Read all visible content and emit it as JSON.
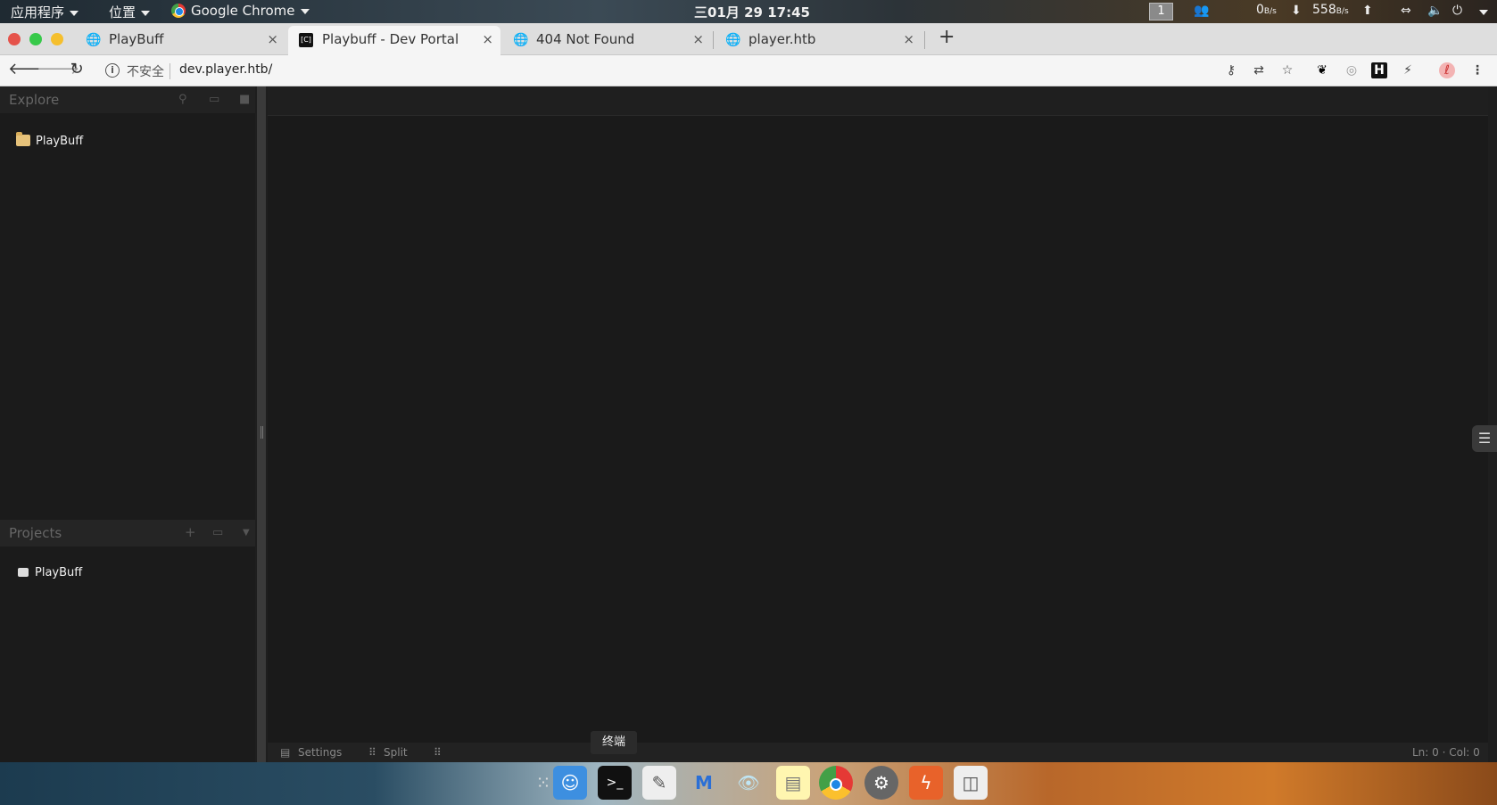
{
  "topbar": {
    "apps_menu": "应用程序",
    "places_menu": "位置",
    "active_app": "Google Chrome",
    "clock": "三01月 29  17:45",
    "workspace": "1",
    "net_down": "0",
    "net_down_unit": "B/s",
    "net_up": "558",
    "net_up_unit": "B/s"
  },
  "tabs": [
    {
      "title": "PlayBuff",
      "close": "×"
    },
    {
      "title": "Playbuff - Dev Portal",
      "close": "×"
    },
    {
      "title": "404 Not Found",
      "close": "×"
    },
    {
      "title": "player.htb",
      "close": "×"
    }
  ],
  "new_tab": "+",
  "omnibox": {
    "security_label": "不安全",
    "url": "dev.player.htb/"
  },
  "explore_panel": {
    "title": "Explore",
    "items": [
      {
        "label": "PlayBuff"
      }
    ]
  },
  "projects_panel": {
    "title": "Projects",
    "add": "+",
    "items": [
      {
        "label": "PlayBuff"
      }
    ]
  },
  "statusbar": {
    "settings": "Settings",
    "split": "Split",
    "cursor": "Ln: 0 · Col: 0"
  },
  "tooltip": "终端",
  "dock": {
    "apps": [
      "apps-grid",
      "finder",
      "terminal",
      "text-editor",
      "malwarebytes",
      "eye-viewer",
      "notes",
      "chrome",
      "system-prefs",
      "burp",
      "app-drawer"
    ]
  },
  "colors": {
    "page_bg": "#1b1b1b",
    "tab_active": "#f5f5f5",
    "tab_strip": "#dedede",
    "folder": "#e6c27a"
  }
}
